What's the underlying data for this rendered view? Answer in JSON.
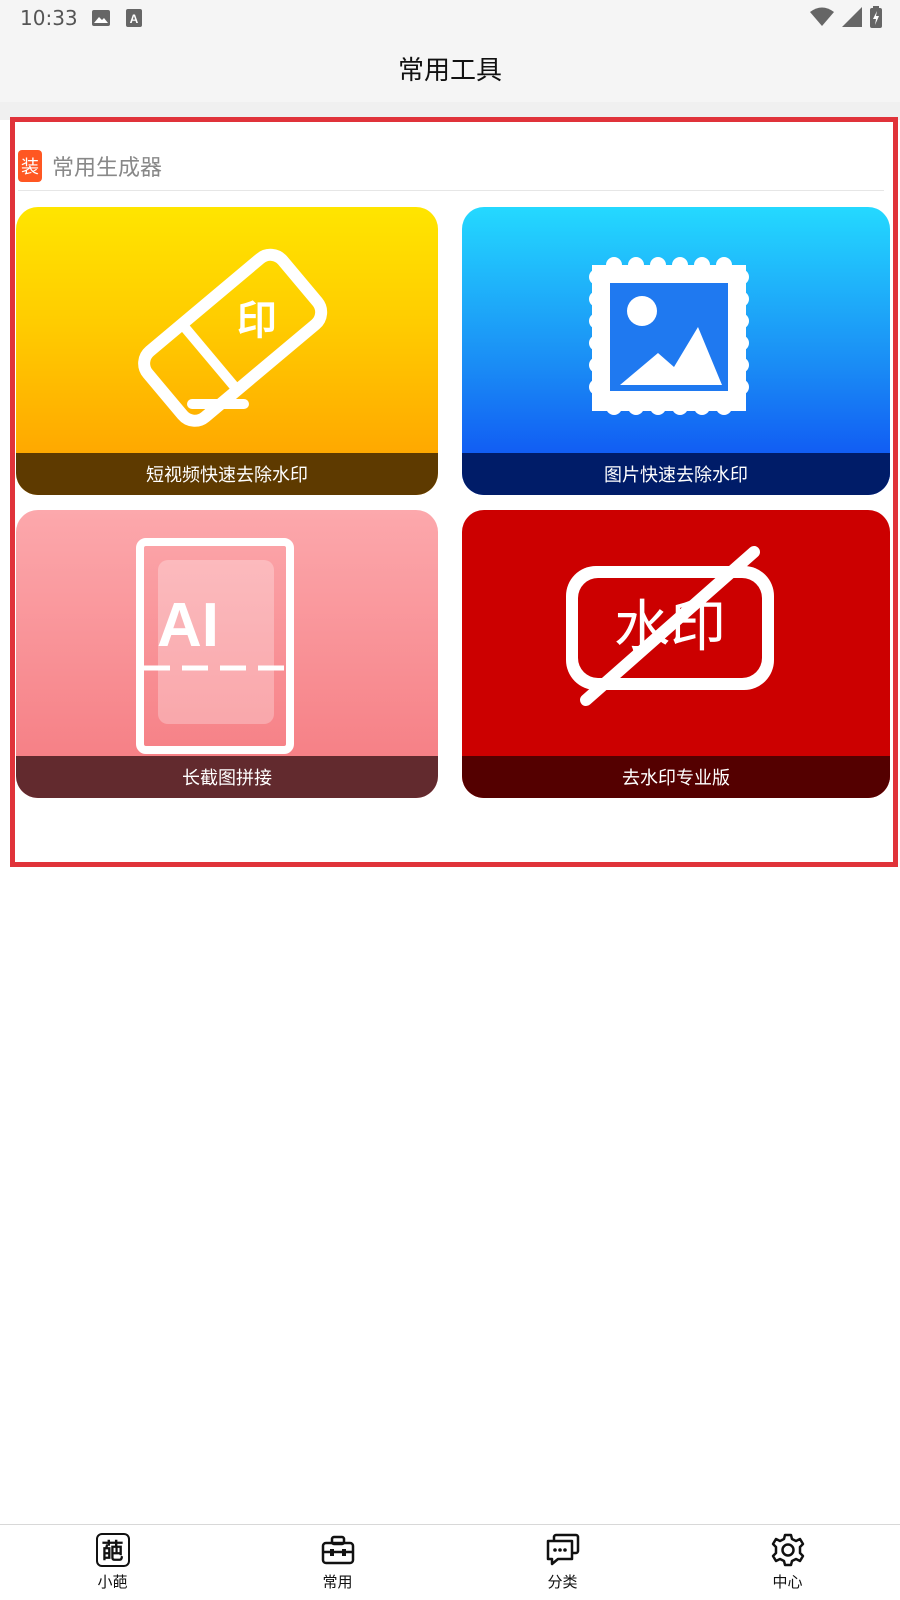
{
  "status_bar": {
    "time": "10:33",
    "icons": [
      "image-icon",
      "a-letter-icon",
      "wifi-icon",
      "signal-icon",
      "battery-icon"
    ]
  },
  "header": {
    "title": "常用工具"
  },
  "section": {
    "badge": "装",
    "title": "常用生成器",
    "accent": "#ff5722"
  },
  "cards": [
    {
      "label": "短视频快速去除水印",
      "icon": "eraser-stamp-icon",
      "art_text": "印"
    },
    {
      "label": "图片快速去除水印",
      "icon": "stamp-picture-icon"
    },
    {
      "label": "长截图拼接",
      "icon": "ai-document-icon",
      "art_text": "AI"
    },
    {
      "label": "去水印专业版",
      "icon": "no-watermark-icon",
      "art_text": "水印"
    }
  ],
  "highlight_color": "#e0333a",
  "bottom_nav": [
    {
      "label": "小葩",
      "icon": "pa-character-icon",
      "icon_text": "葩"
    },
    {
      "label": "常用",
      "icon": "toolbox-icon"
    },
    {
      "label": "分类",
      "icon": "chat-bubbles-icon"
    },
    {
      "label": "中心",
      "icon": "gear-icon"
    }
  ]
}
